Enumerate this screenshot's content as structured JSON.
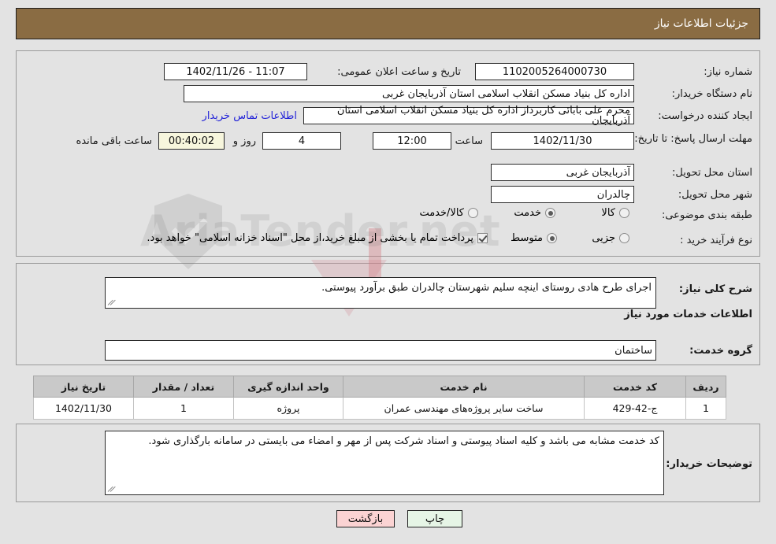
{
  "header": {
    "title": "جزئیات اطلاعات نیاز"
  },
  "watermark": {
    "text": "AriaTender.net"
  },
  "top_form": {
    "need_number_label": "شماره نیاز:",
    "need_number_value": "1102005264000730",
    "public_announce_label": "تاریخ و ساعت اعلان عمومی:",
    "public_announce_value": "11:07 - 1402/11/26",
    "buyer_org_label": "نام دستگاه خریدار:",
    "buyer_org_value": "اداره کل بنیاد مسکن انقلاب اسلامی استان آذربایجان غربی",
    "creator_label": "ایجاد کننده درخواست:",
    "creator_value": "محرم علی بابائی کاربرداز اداره کل بنیاد مسکن انقلاب اسلامی استان آذربایجان",
    "contact_link": "اطلاعات تماس خریدار",
    "deadline_label": "مهلت ارسال پاسخ: تا تاریخ:",
    "deadline_date": "1402/11/30",
    "hour_label": "ساعت",
    "deadline_time": "12:00",
    "days_value": "4",
    "days_label": "روز و",
    "countdown_value": "00:40:02",
    "remaining_label": "ساعت باقی مانده",
    "province_label": "استان محل تحویل:",
    "province_value": "آذربایجان غربی",
    "city_label": "شهر محل تحویل:",
    "city_value": "چالدران",
    "category_label": "طبقه بندی موضوعی:",
    "category_options": [
      {
        "label": "کالا",
        "selected": false
      },
      {
        "label": "خدمت",
        "selected": true
      },
      {
        "label": "کالا/خدمت",
        "selected": false
      }
    ],
    "process_label": "نوع فرآیند خرید :",
    "process_options": [
      {
        "label": "جزیی",
        "selected": false
      },
      {
        "label": "متوسط",
        "selected": true
      }
    ],
    "treasury_checkbox_checked": true,
    "treasury_note": "پرداخت تمام یا بخشی از مبلغ خرید،از محل \"اسناد خزانه اسلامی\" خواهد بود."
  },
  "middle": {
    "summary_label": "شرح کلی نیاز:",
    "summary_value": "اجرای طرح هادی روستای اینچه سلیم شهرستان چالدران طبق برآورد پیوستی.",
    "services_info_heading": "اطلاعات خدمات مورد نیاز",
    "service_group_label": "گروه خدمت:",
    "service_group_value": "ساختمان"
  },
  "table": {
    "columns": [
      "ردیف",
      "کد خدمت",
      "نام خدمت",
      "واحد اندازه گیری",
      "تعداد / مقدار",
      "تاریخ نیاز"
    ],
    "rows": [
      {
        "row": "1",
        "service_code": "ج-42-429",
        "service_name": "ساخت سایر پروژه‌های مهندسی عمران",
        "unit": "پروژه",
        "quantity": "1",
        "need_date": "1402/11/30"
      }
    ]
  },
  "buyer_notes": {
    "label": "توضیحات خریدار:",
    "value": "کد خدمت مشابه می باشد و کلیه اسناد پیوستی و اسناد شرکت پس از مهر و امضاء می بایستی در سامانه بارگذاری شود."
  },
  "footer": {
    "print_label": "چاپ",
    "back_label": "بازگشت"
  },
  "colors": {
    "header_bg": "#8a6c43",
    "link": "#2323d8",
    "countdown_bg": "#f7f6dd",
    "print_bg": "#e6f5e6",
    "back_bg": "#fbd3d3",
    "table_header_bg": "#c9c9c9"
  }
}
